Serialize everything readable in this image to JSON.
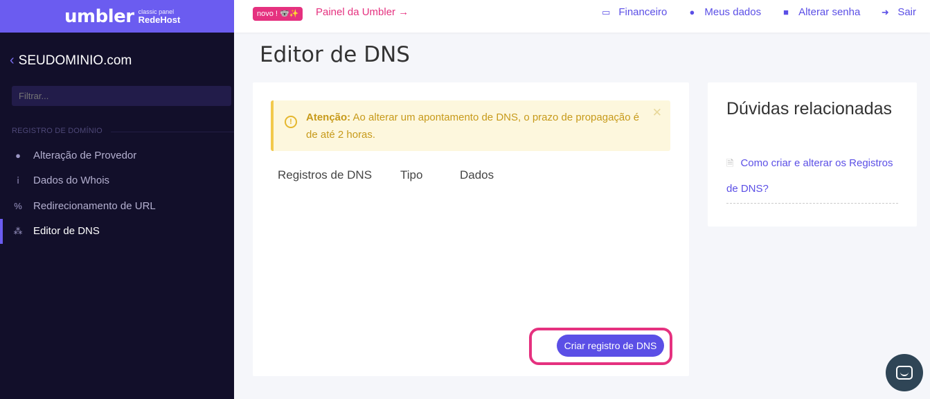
{
  "brand": {
    "logo": "umbler",
    "sub_small": "classic panel",
    "sub_big": "RedeHost"
  },
  "sidebar": {
    "domain": "SEUDOMINIO.com",
    "filter_placeholder": "Filtrar...",
    "section_label": "REGISTRO DE DOMÍNIO",
    "items": [
      {
        "label": "Alteração de Provedor",
        "icon": "globe-icon",
        "glyph": "●"
      },
      {
        "label": "Dados do Whois",
        "icon": "info-icon",
        "glyph": "ⅰ"
      },
      {
        "label": "Redirecionamento de URL",
        "icon": "link-icon",
        "glyph": "%"
      },
      {
        "label": "Editor de DNS",
        "icon": "sitemap-icon",
        "glyph": "⁂",
        "active": true
      }
    ]
  },
  "topbar": {
    "badge": "novo ! 🐨✨",
    "painel_link": "Painel da Umbler →",
    "links": [
      {
        "label": "Financeiro",
        "icon": "credit-card-icon",
        "glyph": "▭"
      },
      {
        "label": "Meus dados",
        "icon": "user-icon",
        "glyph": "●"
      },
      {
        "label": "Alterar senha",
        "icon": "lock-icon",
        "glyph": "■"
      },
      {
        "label": "Sair",
        "icon": "sign-out-icon",
        "glyph": "➜"
      }
    ]
  },
  "main": {
    "title": "Editor de DNS",
    "alert": {
      "strong": "Atenção:",
      "text": " Ao alterar um apontamento de DNS, o prazo de propagação é de até 2 horas.",
      "close": "✕"
    },
    "table_headers": [
      "Registros de DNS",
      "Tipo",
      "Dados"
    ],
    "create_button": "Criar registro de DNS"
  },
  "related": {
    "title": "Dúvidas relacionadas",
    "link": "Como criar e alterar os Registros de DNS?"
  },
  "colors": {
    "accent": "#5b4fe6",
    "highlight": "#e5317f",
    "sidebar_bg": "#120f2a",
    "alert_bg": "#fdf7dd"
  }
}
